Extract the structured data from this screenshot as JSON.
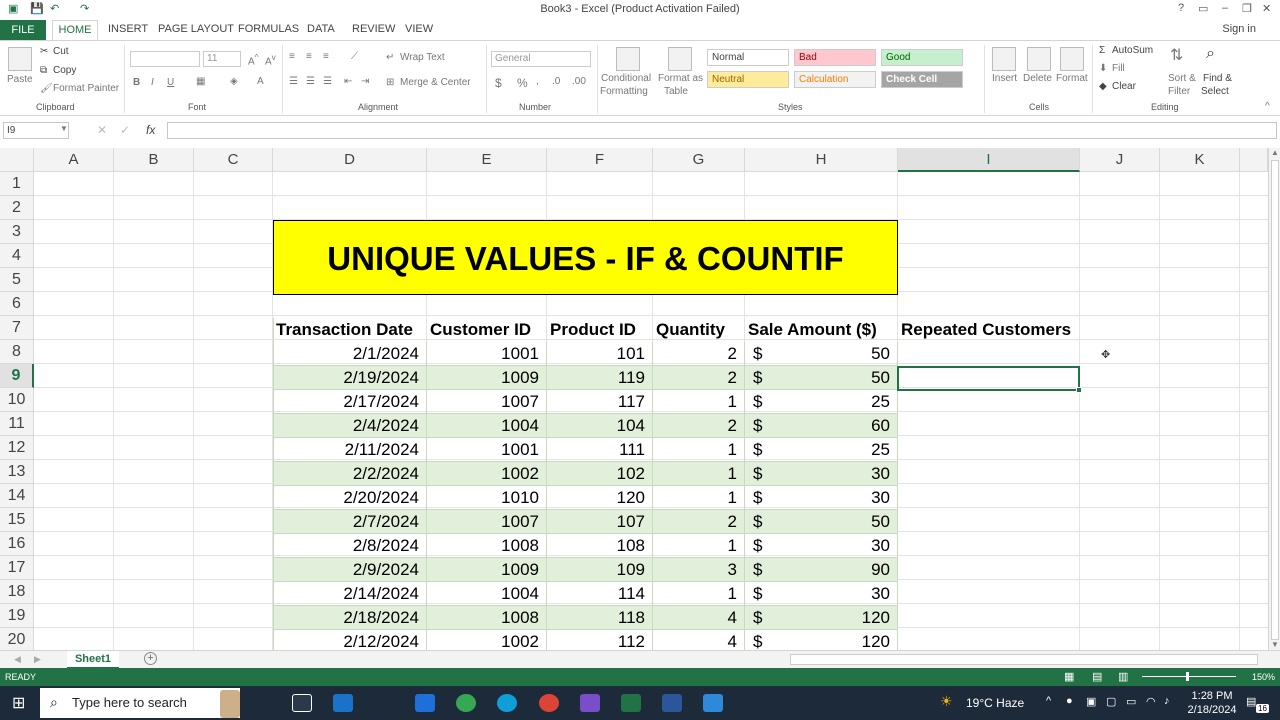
{
  "window": {
    "title": "Book3 - Excel (Product Activation Failed)",
    "help": "?",
    "signin": "Sign in"
  },
  "ribbon_tabs": [
    "FILE",
    "HOME",
    "INSERT",
    "PAGE LAYOUT",
    "FORMULAS",
    "DATA",
    "REVIEW",
    "VIEW"
  ],
  "clipboard": {
    "paste": "Paste",
    "cut": "Cut",
    "copy": "Copy",
    "format_painter": "Format Painter",
    "label": "Clipboard"
  },
  "font": {
    "size": "11",
    "label": "Font",
    "bold": "B",
    "italic": "I",
    "underline": "U"
  },
  "alignment": {
    "wrap": "Wrap Text",
    "merge": "Merge & Center",
    "label": "Alignment"
  },
  "number": {
    "format": "General",
    "label": "Number",
    "currency": "$",
    "percent": "%"
  },
  "styles": {
    "cond1": "Conditional",
    "cond2": "Formatting",
    "fmt1": "Format as",
    "fmt2": "Table",
    "normal": "Normal",
    "bad": "Bad",
    "good": "Good",
    "neutral": "Neutral",
    "calculation": "Calculation",
    "check": "Check Cell",
    "label": "Styles"
  },
  "cells": {
    "insert": "Insert",
    "delete": "Delete",
    "format": "Format",
    "label": "Cells"
  },
  "editing": {
    "autosum": "AutoSum",
    "fill": "Fill",
    "clear": "Clear",
    "sort1": "Sort &",
    "sort2": "Filter",
    "find1": "Find &",
    "find2": "Select",
    "label": "Editing"
  },
  "formula_bar": {
    "name_box": "I9",
    "fx": "fx",
    "formula": ""
  },
  "columns": [
    "A",
    "B",
    "C",
    "D",
    "E",
    "F",
    "G",
    "H",
    "I",
    "J",
    "K"
  ],
  "rows": [
    "1",
    "2",
    "3",
    "4",
    "5",
    "6",
    "7",
    "8",
    "9",
    "10",
    "11",
    "12",
    "13",
    "14",
    "15",
    "16",
    "17",
    "18",
    "19",
    "20"
  ],
  "sheet_title": "UNIQUE VALUES - IF & COUNTIF",
  "table": {
    "headers": [
      "Transaction Date",
      "Customer ID",
      "Product ID",
      "Quantity",
      "Sale Amount ($)",
      "Repeated Customers"
    ],
    "rows": [
      {
        "date": "2/1/2024",
        "cust": "1001",
        "prod": "101",
        "qty": "2",
        "cur": "$",
        "amt": "50"
      },
      {
        "date": "2/19/2024",
        "cust": "1009",
        "prod": "119",
        "qty": "2",
        "cur": "$",
        "amt": "50"
      },
      {
        "date": "2/17/2024",
        "cust": "1007",
        "prod": "117",
        "qty": "1",
        "cur": "$",
        "amt": "25"
      },
      {
        "date": "2/4/2024",
        "cust": "1004",
        "prod": "104",
        "qty": "2",
        "cur": "$",
        "amt": "60"
      },
      {
        "date": "2/11/2024",
        "cust": "1001",
        "prod": "111",
        "qty": "1",
        "cur": "$",
        "amt": "25"
      },
      {
        "date": "2/2/2024",
        "cust": "1002",
        "prod": "102",
        "qty": "1",
        "cur": "$",
        "amt": "30"
      },
      {
        "date": "2/20/2024",
        "cust": "1010",
        "prod": "120",
        "qty": "1",
        "cur": "$",
        "amt": "30"
      },
      {
        "date": "2/7/2024",
        "cust": "1007",
        "prod": "107",
        "qty": "2",
        "cur": "$",
        "amt": "50"
      },
      {
        "date": "2/8/2024",
        "cust": "1008",
        "prod": "108",
        "qty": "1",
        "cur": "$",
        "amt": "30"
      },
      {
        "date": "2/9/2024",
        "cust": "1009",
        "prod": "109",
        "qty": "3",
        "cur": "$",
        "amt": "90"
      },
      {
        "date": "2/14/2024",
        "cust": "1004",
        "prod": "114",
        "qty": "1",
        "cur": "$",
        "amt": "30"
      },
      {
        "date": "2/18/2024",
        "cust": "1008",
        "prod": "118",
        "qty": "4",
        "cur": "$",
        "amt": "120"
      },
      {
        "date": "2/12/2024",
        "cust": "1002",
        "prod": "112",
        "qty": "4",
        "cur": "$",
        "amt": "120"
      }
    ]
  },
  "sheet_tabs": {
    "active": "Sheet1",
    "add": "+"
  },
  "status": {
    "ready": "READY",
    "zoom": "150%"
  },
  "taskbar": {
    "search": "Type here to search",
    "weather": "19°C  Haze",
    "time": "1:28 PM",
    "date": "2/18/2024",
    "notif": "16"
  },
  "colors": {
    "excel_green": "#217346",
    "title_fill": "#ffff00",
    "band_green": "#e2efda"
  }
}
